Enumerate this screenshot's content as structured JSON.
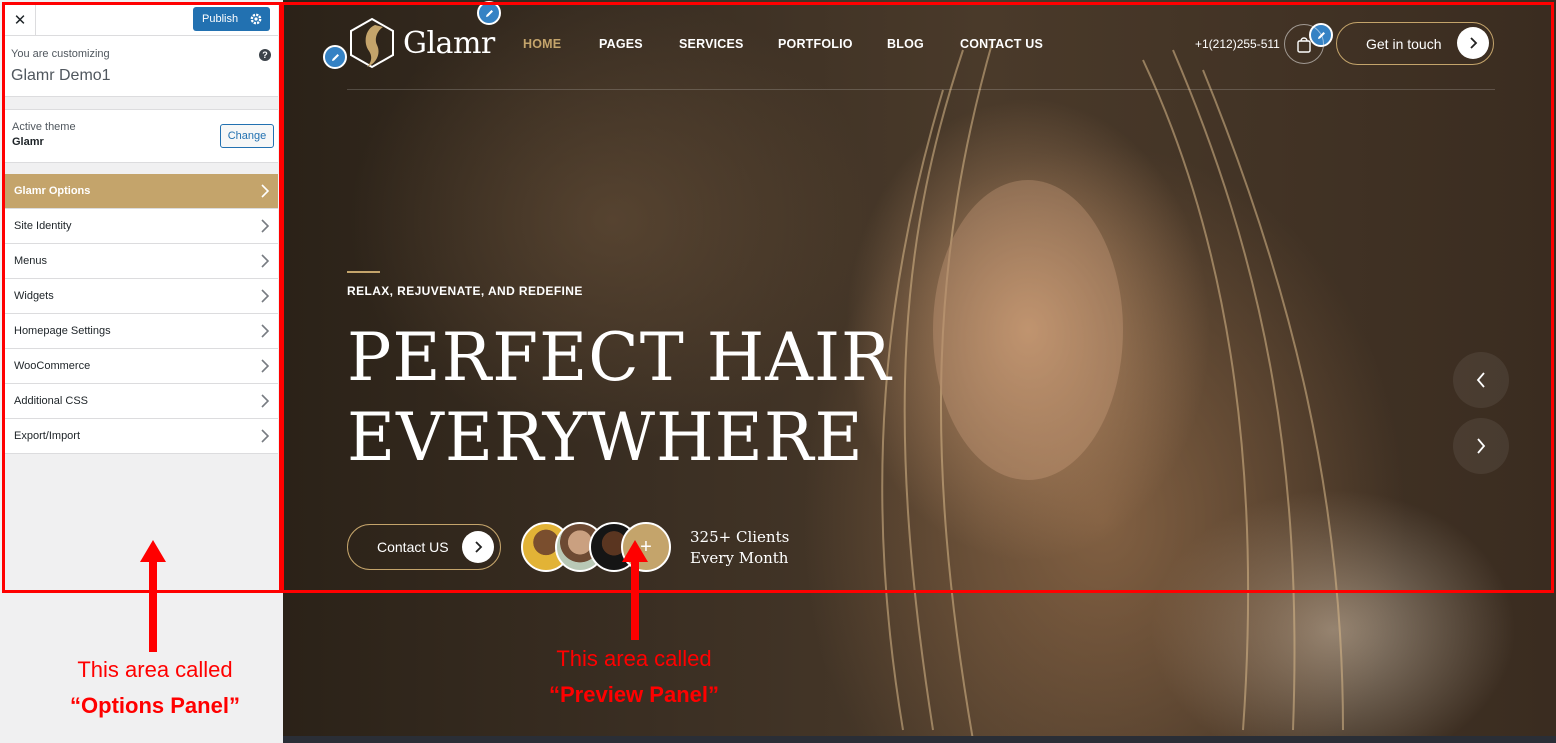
{
  "sidebar": {
    "close_glyph": "✕",
    "publish_label": "Publish",
    "customizing_label": "You are customizing",
    "site_name": "Glamr Demo1",
    "help_glyph": "?",
    "active_theme_label": "Active theme",
    "theme_name": "Glamr",
    "change_label": "Change",
    "items": [
      {
        "label": "Glamr Options",
        "active": true
      },
      {
        "label": "Site Identity"
      },
      {
        "label": "Menus"
      },
      {
        "label": "Widgets"
      },
      {
        "label": "Homepage Settings"
      },
      {
        "label": "WooCommerce"
      },
      {
        "label": "Additional CSS"
      },
      {
        "label": "Export/Import"
      }
    ]
  },
  "preview": {
    "logo_text": "Glamr",
    "nav": [
      "HOME",
      "PAGES",
      "SERVICES",
      "PORTFOLIO",
      "BLOG",
      "CONTACT US"
    ],
    "phone": "+1(212)255-511",
    "get_in_touch": "Get in touch",
    "tagline": "RELAX, REJUVENATE, AND REDEFINE",
    "headline_line1": "PERFECT HAIR",
    "headline_line2": "EVERYWHERE",
    "contact_button": "Contact US",
    "clients_line1": "325+ Clients",
    "clients_line2": "Every Month"
  },
  "annotations": {
    "options_line1": "This area called",
    "options_line2": "“Options Panel”",
    "preview_line1": "This area called",
    "preview_line2": "“Preview Panel”"
  },
  "colors": {
    "accent_gold": "#c4a46b",
    "wp_blue": "#2271b1",
    "annotation_red": "#ff0000"
  }
}
